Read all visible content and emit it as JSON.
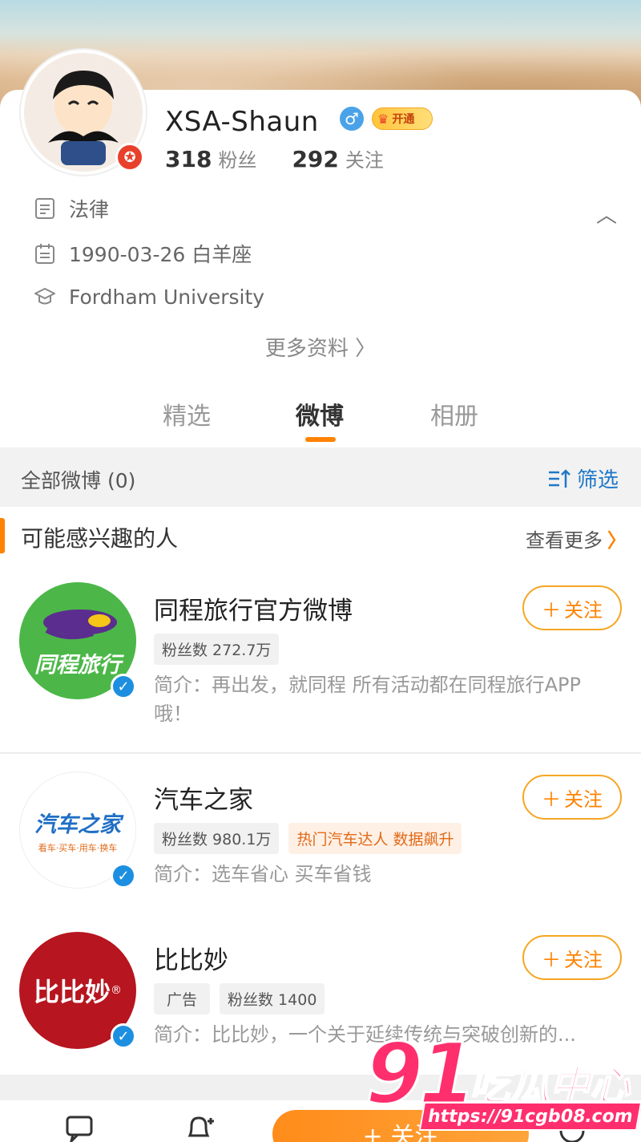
{
  "profile": {
    "name": "XSA-Shaun",
    "gender_icon": "male-icon",
    "vip_label": "开通",
    "followers_count": "318",
    "followers_label": "粉丝",
    "following_count": "292",
    "following_label": "关注",
    "industry": "法律",
    "birthday": "1990-03-26 白羊座",
    "school": "Fordham University",
    "more_info": "更多资料 〉"
  },
  "tabs": [
    {
      "label": "精选"
    },
    {
      "label": "微博"
    },
    {
      "label": "相册"
    }
  ],
  "filter": {
    "all_posts": "全部微博 (0)",
    "filter_label": "筛选"
  },
  "suggestions": {
    "title": "可能感兴趣的人",
    "see_more": "查看更多",
    "users": [
      {
        "name": "同程旅行官方微博",
        "avatar_text": "同程旅行",
        "tags": [
          "粉丝数 272.7万"
        ],
        "desc": "简介：再出发，就同程 所有活动都在同程旅行APP哦！",
        "follow": "关注"
      },
      {
        "name": "汽车之家",
        "avatar_text": "汽车之家",
        "avatar_sub": "看车·买车·用车·换车",
        "tags": [
          "粉丝数 980.1万",
          "热门汽车达人 数据飙升"
        ],
        "desc": "简介：选车省心 买车省钱",
        "follow": "关注"
      },
      {
        "name": "比比妙",
        "avatar_text": "比比妙",
        "tags": [
          "广告",
          "粉丝数 1400"
        ],
        "desc": "简介：比比妙，一个关于延续传统与突破创新的...",
        "follow": "关注"
      }
    ]
  },
  "bottom": {
    "follow_label": "+ 关注"
  },
  "watermark": {
    "number": "91",
    "brand": "吃瓜中心",
    "url": "https://91cgb08.com"
  },
  "colors": {
    "accent": "#ff8200",
    "link_blue": "#1f78c8",
    "verify_blue": "#1d8fe0"
  }
}
